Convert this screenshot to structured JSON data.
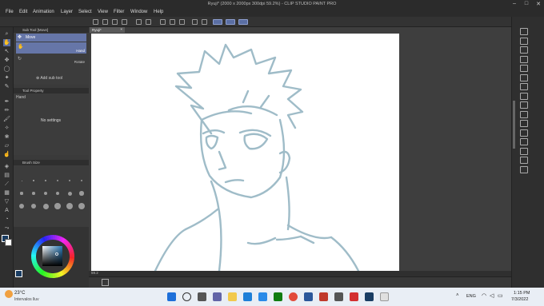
{
  "window": {
    "title": "Ryuji* (2000 x 2000px 300dpi 59.2%) - CLIP STUDIO PAINT PRO",
    "controls": [
      "–",
      "□",
      "✕"
    ]
  },
  "menu": [
    "File",
    "Edit",
    "Animation",
    "Layer",
    "Select",
    "View",
    "Filter",
    "Window",
    "Help"
  ],
  "subtool": {
    "header": "Sub Tool [Move]",
    "items": [
      {
        "label": "Move",
        "sub": ""
      },
      {
        "label": "",
        "sub": "Hand"
      },
      {
        "label": "",
        "sub": "Rotate"
      }
    ],
    "add_label": "Add sub tool"
  },
  "tool_property": {
    "header": "Tool Property",
    "tool_name": "Hand",
    "message": "No settings"
  },
  "brush_size": {
    "header": "Brush Size"
  },
  "canvas": {
    "tab_label": "Ryuji*",
    "zoom": "59.2"
  },
  "color": {
    "main": "#1a3d63",
    "sub": "#ffffff"
  },
  "taskbar": {
    "weather_temp": "23°C",
    "weather_desc": "Intervalos lluv",
    "lang": "ENG",
    "time": "1:15 PM",
    "date": "7/3/2022"
  },
  "colors": {
    "accent": "#6676a8",
    "sketch": "#9fbcc8"
  }
}
